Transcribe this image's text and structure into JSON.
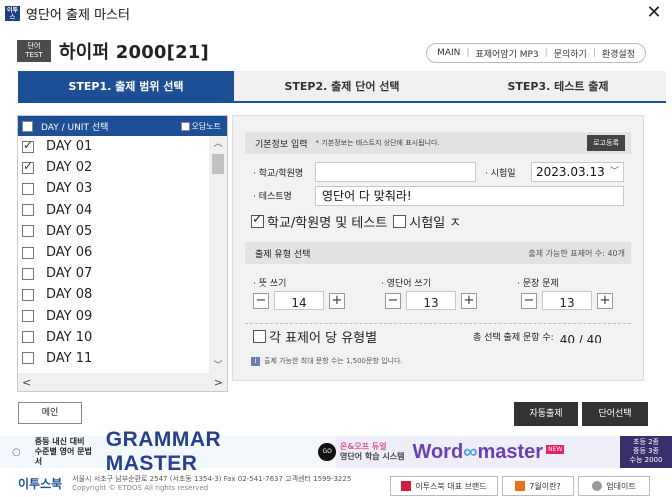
{
  "window": {
    "title": "영단어 출제 마스터",
    "icon_text": "이투스"
  },
  "brand": {
    "badge": "단어\nTEST",
    "name": "하이퍼 2000[21]"
  },
  "top_menu": [
    "MAIN",
    "표제어암기 MP3",
    "문의하기",
    "환경설정"
  ],
  "steps": [
    {
      "label": "STEP1. 출제 범위 선택",
      "active": true
    },
    {
      "label": "STEP2. 출제 단어 선택",
      "active": false
    },
    {
      "label": "STEP3. 테스트 출제",
      "active": false
    }
  ],
  "day_list": {
    "header": "DAY / UNIT 선택",
    "wrong_label": "오답노트",
    "items": [
      {
        "label": "DAY 01",
        "checked": true
      },
      {
        "label": "DAY 02",
        "checked": true
      },
      {
        "label": "DAY 03",
        "checked": false
      },
      {
        "label": "DAY 04",
        "checked": false
      },
      {
        "label": "DAY 05",
        "checked": false
      },
      {
        "label": "DAY 06",
        "checked": false
      },
      {
        "label": "DAY 07",
        "checked": false
      },
      {
        "label": "DAY 08",
        "checked": false
      },
      {
        "label": "DAY 09",
        "checked": false
      },
      {
        "label": "DAY 10",
        "checked": false
      },
      {
        "label": "DAY 11",
        "checked": false
      }
    ]
  },
  "basic_info": {
    "title": "기본정보 입력",
    "note": "* 기본정보는 테스트지 상단에 표시됩니다.",
    "logo_button": "로고등록",
    "school_label": "· 학교/학원명",
    "school_value": "",
    "date_label": "· 시험일",
    "date_value": "2023.03.13",
    "test_label": "· 테스트명",
    "test_value": "영단어 다 맞춰라!",
    "show_option_text": "학교/학원명 및 테스트",
    "show_date_text": "시험일 ㅈ"
  },
  "question_type": {
    "title": "출제 유형 선택",
    "available_text": "출제 가능한 표제어 수: 40개",
    "types": [
      {
        "label": "· 뜻 쓰기",
        "value": "14"
      },
      {
        "label": "· 영단어 쓰기",
        "value": "13"
      },
      {
        "label": "· 문장 문제",
        "value": "13"
      }
    ],
    "per_type_text": "각 표제어 당 유형별",
    "total_label": "총 선택 출제 문항 수:",
    "total_value": "40 / 40",
    "info_text": "출제 가능한 최대 문항 수는 1,500문항 입니다."
  },
  "buttons": {
    "main": "메인",
    "auto": "자동출제",
    "word_select": "단어선택"
  },
  "banner": {
    "left_small": "중등 내신 대비\n수준별 영어 문법서",
    "left_big": "GRAMMAR MASTER",
    "left_go": "GO",
    "right_small1": "온&오프 듀얼",
    "right_small2": "영단어 학습 시스템",
    "right_big1": "Word",
    "right_big_inf": "∞",
    "right_big2": "master",
    "right_new": "NEW",
    "right_grade": "초등 2종\n중등 3종\n수능 2000"
  },
  "footer": {
    "logo": "이투스북",
    "address": "서울시 서초구 남부순환로 2547 (서초동 1354-3)  Fax 02-541-7637  고객센터 1599-3225",
    "copyright": "Copyright © ETOOS All rights reserved",
    "btn_brand": "이투스북 대표 브랜드",
    "btn_what": "7월이란?",
    "btn_update": "업데이트"
  },
  "colors": {
    "primary": "#1d4f96",
    "dark_button": "#333333"
  }
}
